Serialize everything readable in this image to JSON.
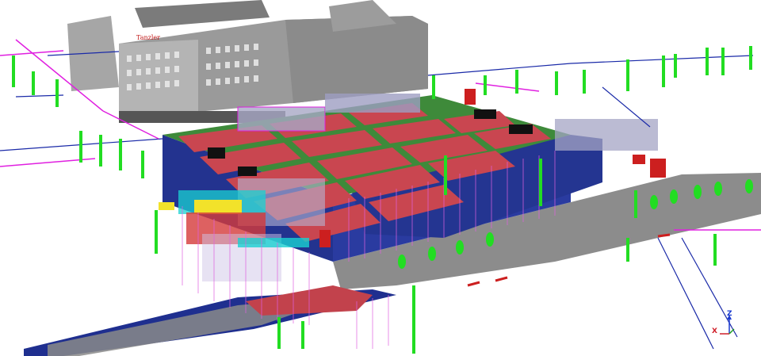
{
  "viewport": {
    "background": "#ffffff"
  },
  "building_sign": {
    "text": "Tanzler"
  },
  "axis_triad": {
    "z_label": "Z",
    "x_label": "X",
    "colors": {
      "z": "#1a3ad0",
      "x": "#d0202a",
      "y": "#22a022"
    }
  },
  "colors": {
    "roof": "#c94650",
    "roof_grid": "#3e8a3a",
    "facade": "#23338f",
    "street": "#8c8c8c",
    "pipes_green": "#22dd22",
    "pipes_magenta": "#e020e0",
    "pipes_blue": "#1a2aa8",
    "tanks_red": "#cc1f1f",
    "hvac_cyan": "#19d1d1",
    "hvac_yellow": "#f2e22a",
    "historic_building": "#8f8f8f"
  }
}
